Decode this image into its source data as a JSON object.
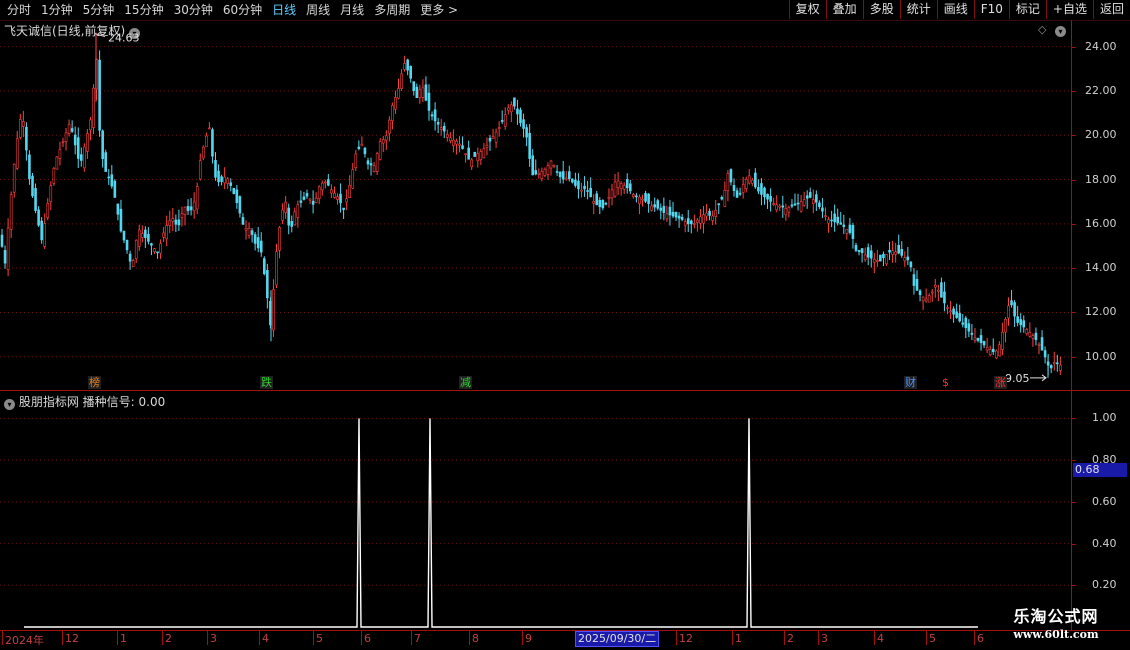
{
  "toolbar": {
    "timeframes": [
      "分时",
      "1分钟",
      "5分钟",
      "15分钟",
      "30分钟",
      "60分钟",
      "日线",
      "周线",
      "月线",
      "多周期",
      "更多 >"
    ],
    "active_timeframe": "日线",
    "buttons": [
      "复权",
      "叠加",
      "多股",
      "统计",
      "画线",
      "F10",
      "标记",
      "+自选",
      "返回"
    ]
  },
  "main_panel": {
    "title": "飞天诚信(日线,前复权)",
    "high_label": "24.63",
    "low_label": "9.05",
    "markers": [
      {
        "text": "榜",
        "color": "#e08020"
      },
      {
        "text": "跌",
        "color": "#30d030"
      },
      {
        "text": "减",
        "color": "#30d030"
      },
      {
        "text": "财",
        "color": "#5090ff"
      },
      {
        "text": "$",
        "color": "#ff3030"
      },
      {
        "text": "涨",
        "color": "#ff3030"
      }
    ]
  },
  "indicator_panel": {
    "title": "股朋指标网",
    "signal_label": "播种信号: 0.00",
    "current_value": "0.68"
  },
  "x_axis": {
    "date_box": "2025/09/30/二",
    "labels": [
      "2024年",
      "12",
      "1",
      "2",
      "3",
      "4",
      "5",
      "6",
      "7",
      "8",
      "9",
      "12",
      "1",
      "2",
      "3",
      "4",
      "5",
      "6"
    ]
  },
  "watermark": {
    "line1": "乐淘公式网",
    "line2": "www.60lt.com"
  },
  "colors": {
    "up": "#ff4040",
    "down": "#54d8f0",
    "grid": "#6a1010",
    "axis": "#a01010",
    "signal": "#ffffff"
  },
  "chart_data": [
    {
      "type": "candlestick",
      "title": "飞天诚信(日线,前复权)",
      "ylim": [
        8.5,
        25.2
      ],
      "yticks": [
        10.0,
        12.0,
        14.0,
        16.0,
        18.0,
        20.0,
        22.0,
        24.0
      ],
      "ytick_labels": [
        "10.00",
        "12.00",
        "14.00",
        "16.00",
        "18.00",
        "20.00",
        "22.00",
        "24.00"
      ],
      "close_path": [
        [
          0,
          15.5
        ],
        [
          5,
          14.2
        ],
        [
          10,
          16.8
        ],
        [
          16,
          19.5
        ],
        [
          22,
          21.2
        ],
        [
          30,
          17.8
        ],
        [
          36,
          16.5
        ],
        [
          42,
          15.2
        ],
        [
          48,
          17.0
        ],
        [
          55,
          18.8
        ],
        [
          62,
          19.6
        ],
        [
          70,
          20.6
        ],
        [
          76,
          19.4
        ],
        [
          80,
          18.6
        ],
        [
          86,
          19.8
        ],
        [
          92,
          21.0
        ],
        [
          96,
          24.0
        ],
        [
          100,
          19.8
        ],
        [
          104,
          18.5
        ],
        [
          110,
          18.0
        ],
        [
          116,
          17.0
        ],
        [
          120,
          15.8
        ],
        [
          126,
          15.0
        ],
        [
          132,
          14.0
        ],
        [
          138,
          15.8
        ],
        [
          145,
          15.4
        ],
        [
          152,
          15.0
        ],
        [
          158,
          14.7
        ],
        [
          165,
          15.8
        ],
        [
          172,
          16.3
        ],
        [
          178,
          15.8
        ],
        [
          184,
          16.8
        ],
        [
          190,
          16.5
        ],
        [
          196,
          17.2
        ],
        [
          200,
          18.8
        ],
        [
          205,
          19.8
        ],
        [
          210,
          20.4
        ],
        [
          214,
          18.2
        ],
        [
          220,
          17.8
        ],
        [
          226,
          18.2
        ],
        [
          232,
          17.6
        ],
        [
          238,
          16.8
        ],
        [
          244,
          15.8
        ],
        [
          250,
          15.8
        ],
        [
          256,
          15.0
        ],
        [
          261,
          14.8
        ],
        [
          266,
          13.2
        ],
        [
          271,
          11.2
        ],
        [
          275,
          14.2
        ],
        [
          280,
          16.0
        ],
        [
          285,
          17.2
        ],
        [
          290,
          15.5
        ],
        [
          296,
          16.8
        ],
        [
          302,
          17.0
        ],
        [
          308,
          17.3
        ],
        [
          314,
          16.8
        ],
        [
          320,
          17.8
        ],
        [
          326,
          17.9
        ],
        [
          332,
          17.5
        ],
        [
          338,
          17.2
        ],
        [
          344,
          16.6
        ],
        [
          350,
          17.8
        ],
        [
          356,
          19.2
        ],
        [
          362,
          19.6
        ],
        [
          368,
          18.7
        ],
        [
          374,
          18.6
        ],
        [
          380,
          19.7
        ],
        [
          386,
          19.9
        ],
        [
          392,
          21.3
        ],
        [
          398,
          22.0
        ],
        [
          404,
          23.3
        ],
        [
          410,
          22.7
        ],
        [
          416,
          21.6
        ],
        [
          422,
          22.3
        ],
        [
          428,
          21.2
        ],
        [
          434,
          20.7
        ],
        [
          440,
          20.4
        ],
        [
          446,
          20.1
        ],
        [
          452,
          19.8
        ],
        [
          458,
          19.7
        ],
        [
          464,
          19.3
        ],
        [
          470,
          18.8
        ],
        [
          476,
          19.1
        ],
        [
          482,
          19.3
        ],
        [
          488,
          19.6
        ],
        [
          494,
          20.0
        ],
        [
          500,
          20.4
        ],
        [
          505,
          20.9
        ],
        [
          510,
          21.4
        ],
        [
          515,
          21.3
        ],
        [
          520,
          20.6
        ],
        [
          526,
          20.1
        ],
        [
          532,
          18.2
        ],
        [
          540,
          18.3
        ],
        [
          546,
          18.5
        ],
        [
          552,
          18.9
        ],
        [
          556,
          18.4
        ],
        [
          562,
          18.0
        ],
        [
          568,
          18.1
        ],
        [
          574,
          17.8
        ],
        [
          580,
          17.5
        ],
        [
          586,
          17.6
        ],
        [
          592,
          17.1
        ],
        [
          598,
          16.8
        ],
        [
          604,
          16.7
        ],
        [
          610,
          17.3
        ],
        [
          616,
          18.0
        ],
        [
          622,
          17.8
        ],
        [
          628,
          17.6
        ],
        [
          634,
          17.3
        ],
        [
          640,
          17.2
        ],
        [
          646,
          17.0
        ],
        [
          652,
          16.8
        ],
        [
          658,
          16.7
        ],
        [
          664,
          16.5
        ],
        [
          670,
          16.4
        ],
        [
          676,
          16.3
        ],
        [
          682,
          16.2
        ],
        [
          688,
          16.0
        ],
        [
          694,
          16.0
        ],
        [
          700,
          16.3
        ],
        [
          706,
          16.5
        ],
        [
          712,
          16.3
        ],
        [
          718,
          16.8
        ],
        [
          724,
          17.3
        ],
        [
          728,
          18.3
        ],
        [
          733,
          17.6
        ],
        [
          738,
          17.1
        ],
        [
          744,
          17.9
        ],
        [
          750,
          18.2
        ],
        [
          756,
          17.6
        ],
        [
          762,
          17.3
        ],
        [
          768,
          17.1
        ],
        [
          774,
          16.9
        ],
        [
          780,
          16.8
        ],
        [
          786,
          16.7
        ],
        [
          792,
          16.8
        ],
        [
          798,
          16.9
        ],
        [
          804,
          17.1
        ],
        [
          810,
          17.2
        ],
        [
          816,
          17.0
        ],
        [
          822,
          16.6
        ],
        [
          828,
          16.2
        ],
        [
          834,
          16.1
        ],
        [
          840,
          16.0
        ],
        [
          846,
          15.8
        ],
        [
          852,
          15.5
        ],
        [
          856,
          14.8
        ],
        [
          862,
          14.7
        ],
        [
          868,
          14.5
        ],
        [
          874,
          14.4
        ],
        [
          880,
          14.3
        ],
        [
          886,
          14.6
        ],
        [
          892,
          14.8
        ],
        [
          898,
          14.7
        ],
        [
          904,
          14.5
        ],
        [
          910,
          14.3
        ],
        [
          914,
          13.2
        ],
        [
          920,
          12.8
        ],
        [
          926,
          12.6
        ],
        [
          932,
          12.9
        ],
        [
          936,
          13.3
        ],
        [
          940,
          12.8
        ],
        [
          946,
          12.3
        ],
        [
          952,
          12.0
        ],
        [
          958,
          11.7
        ],
        [
          964,
          11.4
        ],
        [
          970,
          11.1
        ],
        [
          976,
          10.8
        ],
        [
          982,
          10.6
        ],
        [
          988,
          10.4
        ],
        [
          994,
          10.2
        ],
        [
          998,
          10.3
        ],
        [
          1004,
          11.4
        ],
        [
          1010,
          12.6
        ],
        [
          1016,
          11.6
        ],
        [
          1022,
          11.4
        ],
        [
          1028,
          11.2
        ],
        [
          1034,
          10.9
        ],
        [
          1040,
          10.5
        ],
        [
          1045,
          10.0
        ],
        [
          1050,
          9.4
        ],
        [
          1055,
          9.8
        ],
        [
          1061,
          9.6
        ],
        [
          1065,
          9.9
        ]
      ]
    },
    {
      "type": "line",
      "title": "股朋指标网 播种信号",
      "ylim": [
        0,
        1.05
      ],
      "yticks": [
        0.2,
        0.4,
        0.6,
        0.8,
        1.0
      ],
      "ytick_labels": [
        "0.20",
        "0.40",
        "0.60",
        "0.80",
        "1.00"
      ],
      "series": [
        {
          "name": "播种信号",
          "spikes_at_x": [
            359,
            430,
            749
          ],
          "value": 1.0,
          "baseline": 0.0
        }
      ]
    }
  ]
}
